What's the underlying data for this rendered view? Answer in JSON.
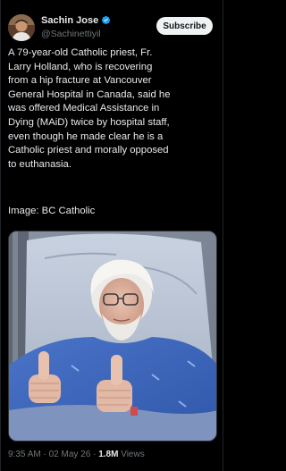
{
  "author": {
    "display_name": "Sachin Jose",
    "handle": "@Sachinettiyil",
    "verified_icon": "verified-badge-icon",
    "verified_color": "#1d9bf0"
  },
  "subscribe_label": "Subscribe",
  "tweet_text": "A 79-year-old Catholic priest, Fr.\nLarry Holland, who is recovering\nfrom a hip fracture at Vancouver\nGeneral Hospital in Canada, said he\nwas offered Medical Assistance in\nDying (MAiD) twice by hospital staff,\neven though he made clear he is a\nCatholic priest and morally opposed\nto euthanasia.",
  "image_credit": "Image: BC Catholic",
  "media_alt": "",
  "meta": {
    "time": "9:35 AM",
    "sep1": " · ",
    "date": "02 May 26",
    "sep2": " · ",
    "views_count": "1.8M",
    "views_label": " Views"
  },
  "colors": {
    "background": "#000000",
    "text_primary": "#e7e9ea",
    "text_secondary": "#71767b",
    "subscribe_bg": "#eff3f4"
  }
}
